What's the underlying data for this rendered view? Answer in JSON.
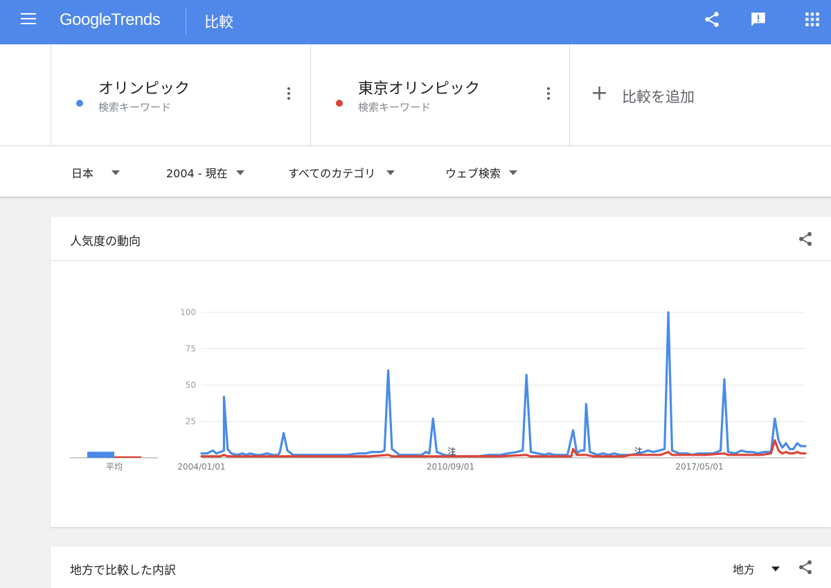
{
  "appbar": {
    "logo_google": "Google",
    "logo_trends": "Trends",
    "title": "比較",
    "icons": [
      "menu-icon",
      "share-icon",
      "feedback-icon",
      "apps-icon"
    ]
  },
  "colors": {
    "appbar": "#5088e9",
    "series1": "#4a8be8",
    "series2": "#db4437"
  },
  "compare": {
    "terms": [
      {
        "name": "オリンピック",
        "type": "検索キーワード",
        "color": "#4a8be8"
      },
      {
        "name": "東京オリンピック",
        "type": "検索キーワード",
        "color": "#db4437"
      }
    ],
    "add_label": "比較を追加",
    "add_icon": "+"
  },
  "filters": {
    "region": "日本",
    "time": "2004 - 現在",
    "category": "すべてのカテゴリ",
    "search_type": "ウェブ検索"
  },
  "trend_card": {
    "title": "人気度の動向",
    "avg_label": "平均"
  },
  "chart_data": {
    "type": "line",
    "title": "",
    "xlabel": "",
    "ylabel": "",
    "ylim": [
      0,
      100
    ],
    "yticks": [
      25,
      50,
      75,
      100
    ],
    "ytick_labels": [
      "25",
      "50",
      "75",
      "100"
    ],
    "xtick_labels": [
      {
        "label": "2004/01/01",
        "x": 2004.0
      },
      {
        "label": "2010/09/01",
        "x": 2010.667
      },
      {
        "label": "2017/05/01",
        "x": 2017.333
      }
    ],
    "xlim": [
      2004.0,
      2020.17
    ],
    "grid": true,
    "annotations": [
      {
        "text": "注",
        "x": 2010.7
      },
      {
        "text": "注",
        "x": 2015.7
      }
    ],
    "averages": [
      {
        "series": "オリンピック",
        "value": 4
      },
      {
        "series": "東京オリンピック",
        "value": 1
      }
    ],
    "series": [
      {
        "name": "オリンピック",
        "color": "#4a8be8",
        "points": [
          [
            2004.0,
            3
          ],
          [
            2004.15,
            3
          ],
          [
            2004.3,
            5
          ],
          [
            2004.4,
            3
          ],
          [
            2004.5,
            4
          ],
          [
            2004.6,
            5
          ],
          [
            2004.52,
            4
          ],
          [
            2004.6,
            42
          ],
          [
            2004.7,
            6
          ],
          [
            2004.8,
            3
          ],
          [
            2004.95,
            2
          ],
          [
            2005.1,
            3
          ],
          [
            2005.2,
            2
          ],
          [
            2005.3,
            3
          ],
          [
            2005.45,
            2
          ],
          [
            2005.6,
            2
          ],
          [
            2005.75,
            3
          ],
          [
            2005.9,
            2
          ],
          [
            2006.05,
            2
          ],
          [
            2006.1,
            4
          ],
          [
            2006.2,
            17
          ],
          [
            2006.3,
            5
          ],
          [
            2006.45,
            2
          ],
          [
            2006.7,
            2
          ],
          [
            2007.0,
            2
          ],
          [
            2007.3,
            2
          ],
          [
            2007.6,
            2
          ],
          [
            2007.9,
            2
          ],
          [
            2008.2,
            3
          ],
          [
            2008.4,
            3
          ],
          [
            2008.55,
            4
          ],
          [
            2008.8,
            4
          ],
          [
            2008.9,
            5
          ],
          [
            2009.0,
            60
          ],
          [
            2009.1,
            6
          ],
          [
            2009.3,
            2
          ],
          [
            2009.6,
            2
          ],
          [
            2009.9,
            2
          ],
          [
            2010.0,
            4
          ],
          [
            2010.1,
            3
          ],
          [
            2010.2,
            27
          ],
          [
            2010.3,
            4
          ],
          [
            2010.5,
            2
          ],
          [
            2010.8,
            1
          ],
          [
            2011.1,
            1
          ],
          [
            2011.4,
            1
          ],
          [
            2011.7,
            2
          ],
          [
            2012.0,
            2
          ],
          [
            2012.2,
            3
          ],
          [
            2012.45,
            4
          ],
          [
            2012.6,
            5
          ],
          [
            2012.7,
            57
          ],
          [
            2012.82,
            4
          ],
          [
            2013.0,
            3
          ],
          [
            2013.2,
            2
          ],
          [
            2013.3,
            3
          ],
          [
            2013.45,
            2
          ],
          [
            2013.6,
            2
          ],
          [
            2013.8,
            2
          ],
          [
            2013.95,
            19
          ],
          [
            2014.05,
            3
          ],
          [
            2014.15,
            5
          ],
          [
            2014.25,
            5
          ],
          [
            2014.3,
            37
          ],
          [
            2014.4,
            4
          ],
          [
            2014.6,
            2
          ],
          [
            2014.75,
            3
          ],
          [
            2014.9,
            2
          ],
          [
            2015.05,
            3
          ],
          [
            2015.2,
            2
          ],
          [
            2015.5,
            2
          ],
          [
            2015.7,
            3
          ],
          [
            2015.85,
            4
          ],
          [
            2015.95,
            5
          ],
          [
            2016.1,
            4
          ],
          [
            2016.25,
            5
          ],
          [
            2016.4,
            6
          ],
          [
            2016.5,
            100
          ],
          [
            2016.6,
            5
          ],
          [
            2016.8,
            3
          ],
          [
            2017.0,
            3
          ],
          [
            2017.15,
            2
          ],
          [
            2017.3,
            3
          ],
          [
            2017.5,
            3
          ],
          [
            2017.7,
            3
          ],
          [
            2017.9,
            5
          ],
          [
            2018.0,
            54
          ],
          [
            2018.1,
            4
          ],
          [
            2018.3,
            3
          ],
          [
            2018.45,
            5
          ],
          [
            2018.6,
            4
          ],
          [
            2018.75,
            4
          ],
          [
            2018.9,
            3
          ],
          [
            2019.05,
            4
          ],
          [
            2019.25,
            4
          ],
          [
            2019.35,
            27
          ],
          [
            2019.45,
            12
          ],
          [
            2019.55,
            7
          ],
          [
            2019.65,
            10
          ],
          [
            2019.75,
            6
          ],
          [
            2019.85,
            6
          ],
          [
            2019.95,
            10
          ],
          [
            2020.05,
            8
          ],
          [
            2020.17,
            8
          ]
        ]
      },
      {
        "name": "東京オリンピック",
        "color": "#db4437",
        "points": [
          [
            2004.0,
            1
          ],
          [
            2004.5,
            1
          ],
          [
            2004.6,
            2
          ],
          [
            2004.7,
            1
          ],
          [
            2005.5,
            1
          ],
          [
            2006.5,
            1
          ],
          [
            2007.5,
            1
          ],
          [
            2008.5,
            1
          ],
          [
            2009.0,
            2
          ],
          [
            2009.1,
            1
          ],
          [
            2010.0,
            1
          ],
          [
            2011.0,
            1
          ],
          [
            2012.0,
            1
          ],
          [
            2012.7,
            2
          ],
          [
            2012.8,
            1
          ],
          [
            2013.5,
            1
          ],
          [
            2013.9,
            1
          ],
          [
            2013.95,
            6
          ],
          [
            2014.05,
            2
          ],
          [
            2014.3,
            2
          ],
          [
            2014.5,
            1
          ],
          [
            2015.0,
            1
          ],
          [
            2015.3,
            1
          ],
          [
            2015.5,
            2
          ],
          [
            2015.7,
            2
          ],
          [
            2016.0,
            2
          ],
          [
            2016.3,
            2
          ],
          [
            2016.5,
            4
          ],
          [
            2016.6,
            2
          ],
          [
            2017.0,
            2
          ],
          [
            2017.5,
            2
          ],
          [
            2018.0,
            3
          ],
          [
            2018.1,
            2
          ],
          [
            2018.5,
            2
          ],
          [
            2019.0,
            2
          ],
          [
            2019.25,
            3
          ],
          [
            2019.35,
            12
          ],
          [
            2019.45,
            5
          ],
          [
            2019.55,
            3
          ],
          [
            2019.65,
            4
          ],
          [
            2019.75,
            3
          ],
          [
            2019.85,
            3
          ],
          [
            2019.95,
            4
          ],
          [
            2020.05,
            3
          ],
          [
            2020.17,
            3
          ]
        ]
      }
    ]
  },
  "region_card": {
    "title": "地方で比較した内訳",
    "select_value": "地方"
  }
}
